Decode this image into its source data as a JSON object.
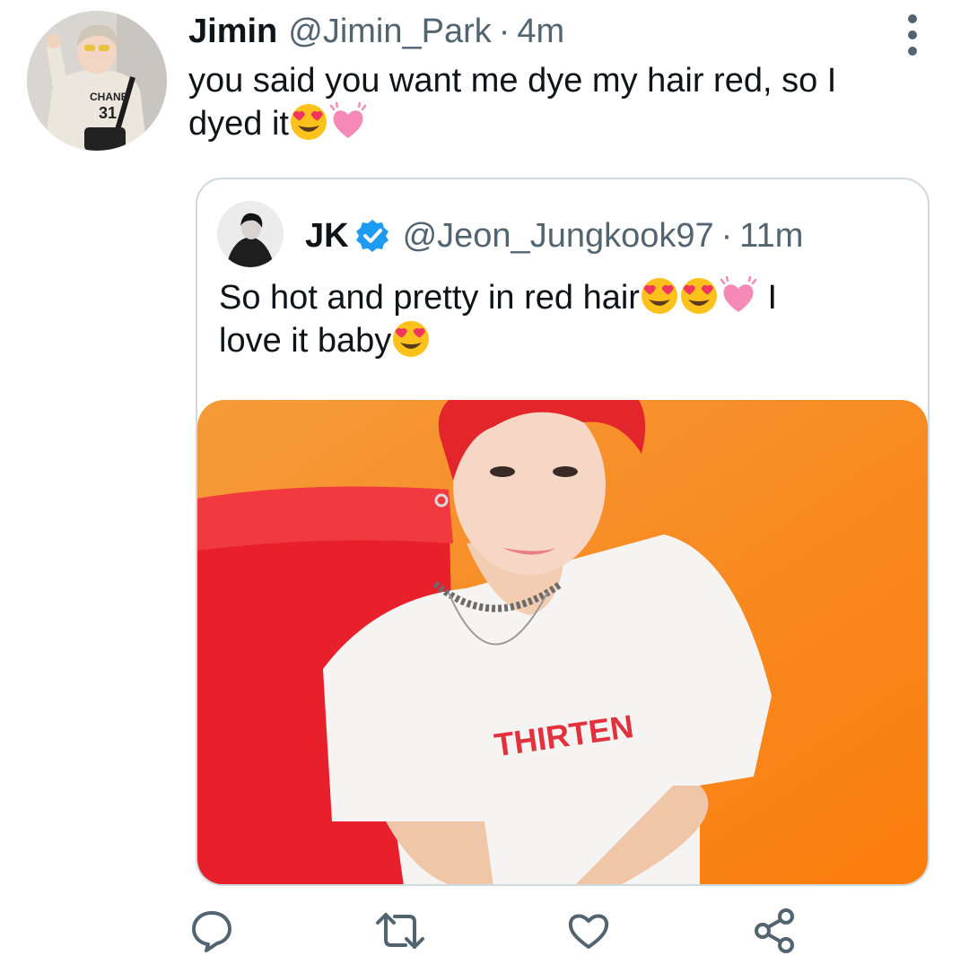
{
  "tweet": {
    "display_name": "Jimin",
    "handle": "@Jimin_Park",
    "separator": "·",
    "time": "4m",
    "text_line1": "you said you want me dye my hair red, so I",
    "text_line2": "dyed it",
    "emojis_main": [
      "smiling-face-with-heart-eyes",
      "beating-heart"
    ],
    "avatar_print": {
      "line1": "CHANE",
      "line2": "31"
    }
  },
  "quote": {
    "display_name": "JK",
    "verified": true,
    "handle": "@Jeon_Jungkook97",
    "separator": "·",
    "time": "11m",
    "text_part1": "So hot and pretty in red hair",
    "text_part2": " I",
    "text_line2": "love it baby",
    "media": {
      "shirt_print": "THIRTEN"
    }
  },
  "actions": {
    "reply": "reply-icon",
    "retweet": "retweet-icon",
    "like": "heart-icon",
    "share": "share-icon"
  },
  "colors": {
    "text": "#0f1419",
    "secondary": "#536471",
    "verified": "#1d9bf0",
    "border": "#cfd9de",
    "media_orange": "#f98a1f",
    "hair_red": "#e52a2a"
  }
}
